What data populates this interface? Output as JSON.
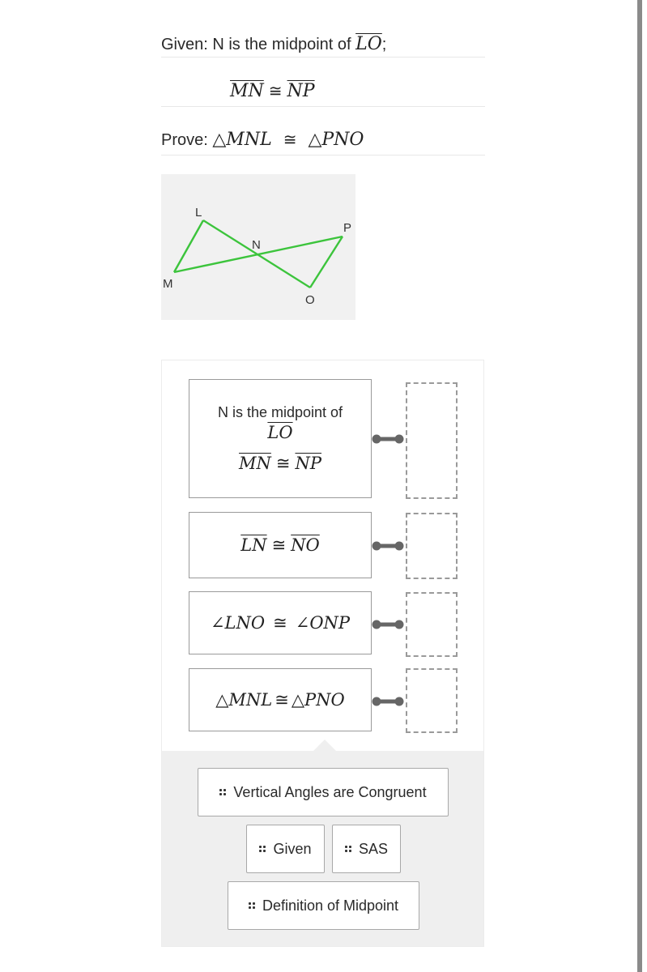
{
  "problem": {
    "given_label": "Given: N is the midpoint of",
    "given_segment": "LO",
    "given_suffix": ";",
    "given2": {
      "left": "MN",
      "symbol": "≅",
      "right": "NP"
    },
    "prove_label": "Prove:",
    "prove": {
      "left_tri": "△",
      "left": "MNL",
      "symbol": "≅",
      "right_tri": "△",
      "right": "PNO"
    }
  },
  "diagram": {
    "line_color": "#3cc43c",
    "points": [
      {
        "name": "L"
      },
      {
        "name": "M"
      },
      {
        "name": "N"
      },
      {
        "name": "P"
      },
      {
        "name": "O"
      }
    ]
  },
  "proof": {
    "statements": [
      {
        "text": "N is the midpoint of",
        "math1": "LO",
        "math2_left": "MN",
        "math2_symbol": "≅",
        "math2_right": "NP",
        "reason": ""
      },
      {
        "left": "LN",
        "symbol": "≅",
        "right": "NO",
        "reason": ""
      },
      {
        "left_angle": "∠",
        "left": "LNO",
        "symbol": "≅",
        "right_angle": "∠",
        "right": "ONP",
        "reason": ""
      },
      {
        "left_tri": "△",
        "left": "MNL",
        "symbol": "≅",
        "right_tri": "△",
        "right": "PNO",
        "reason": ""
      }
    ],
    "reason_bank": [
      {
        "label": "Vertical Angles are Congruent",
        "icon": "drag-grip-icon"
      },
      {
        "label": "Given",
        "icon": "drag-grip-icon"
      },
      {
        "label": "SAS",
        "icon": "drag-grip-icon"
      },
      {
        "label": "Definition of Midpoint",
        "icon": "drag-grip-icon"
      }
    ]
  }
}
